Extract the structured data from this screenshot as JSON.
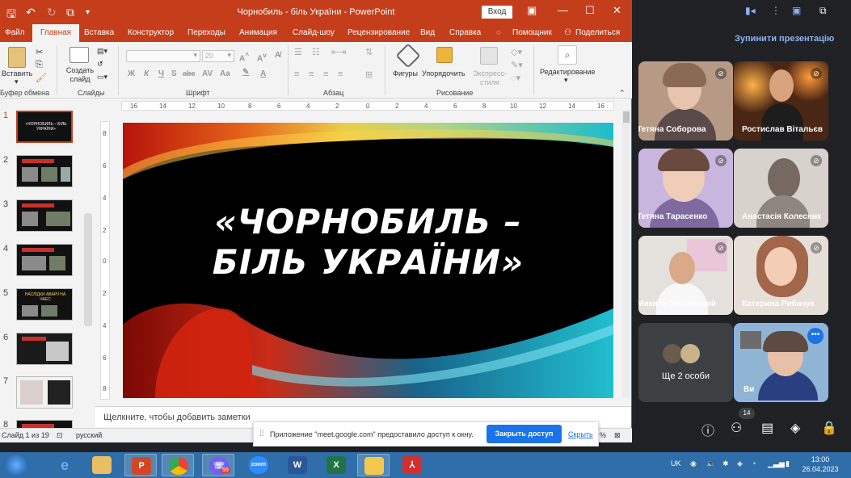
{
  "window": {
    "title": "Чорнобиль - біль України  -  PowerPoint",
    "login_label": "Вход"
  },
  "tabs": [
    "Файл",
    "Главная",
    "Вставка",
    "Конструктор",
    "Переходы",
    "Анимация",
    "Слайд-шоу",
    "Рецензирование",
    "Вид",
    "Справка",
    "Помощник",
    "Поделиться"
  ],
  "ribbon": {
    "paste": "Вставить",
    "new_slide": "Создать слайд",
    "font_size": "20",
    "shapes": "Фигуры",
    "arrange": "Упорядочить",
    "quick_styles": "Экспресс-стили",
    "editing": "Редактирование",
    "groups": {
      "clipboard": "Буфер обмена",
      "slides": "Слайды",
      "font": "Шрифт",
      "paragraph": "Абзац",
      "drawing": "Рисование"
    },
    "font_buttons": [
      "Ж",
      "К",
      "Ч",
      "S",
      "abc",
      "Aa",
      "A"
    ]
  },
  "ruler": {
    "h_ticks": [
      "16",
      "14",
      "12",
      "10",
      "8",
      "6",
      "4",
      "2",
      "0",
      "2",
      "4",
      "6",
      "8",
      "10",
      "12",
      "14",
      "16"
    ],
    "v_ticks": [
      "8",
      "6",
      "4",
      "2",
      "0",
      "2",
      "4",
      "6",
      "8"
    ]
  },
  "thumbnails": [
    {
      "num": "1",
      "text": "«ЧОРНОБИЛЬ – БІЛЬ УКРАЇНИ»"
    },
    {
      "num": "2",
      "text": ""
    },
    {
      "num": "3",
      "text": ""
    },
    {
      "num": "4",
      "text": ""
    },
    {
      "num": "5",
      "text": "НАСЛІДКИ АВАРІЇ НА ЧАЕС"
    },
    {
      "num": "6",
      "text": ""
    },
    {
      "num": "7",
      "text": ""
    },
    {
      "num": "8",
      "text": ""
    }
  ],
  "slide": {
    "title_line1": "«ЧОРНОБИЛЬ –",
    "title_line2": "БІЛЬ УКРАЇНИ»"
  },
  "notes_placeholder": "Щелкните, чтобы добавить заметки",
  "status": {
    "slide_of": "Слайд 1 из 19",
    "language": "русский",
    "zoom_suffix": "%"
  },
  "notification": {
    "message": "Приложение \"meet.google.com\" предоставило доступ к окну.",
    "close_access": "Закрыть доступ",
    "hide": "Скрыть"
  },
  "meet": {
    "stop_presenting": "Зупинити презентацію",
    "participants_count": "14",
    "others_label": "Ще 2 особи",
    "participants": [
      {
        "name": "Тетяна Соборова"
      },
      {
        "name": "Ростислав Вітальєв"
      },
      {
        "name": "Тетяна Тарасенко"
      },
      {
        "name": "Анастасія Колесник"
      },
      {
        "name": "Микита Заболотний"
      },
      {
        "name": "Катерина Рибачук"
      },
      {
        "name": "Ви"
      }
    ]
  },
  "taskbar": {
    "lang": "UK",
    "time": "13:00",
    "date": "26.04.2023",
    "viber_badge": "99",
    "zoom_label": "zoom"
  },
  "colors": {
    "ppt_accent": "#c43e1c",
    "meet_bg": "#202124",
    "meet_accent": "#8ab4f8",
    "taskbar": "#2f6ea8"
  }
}
